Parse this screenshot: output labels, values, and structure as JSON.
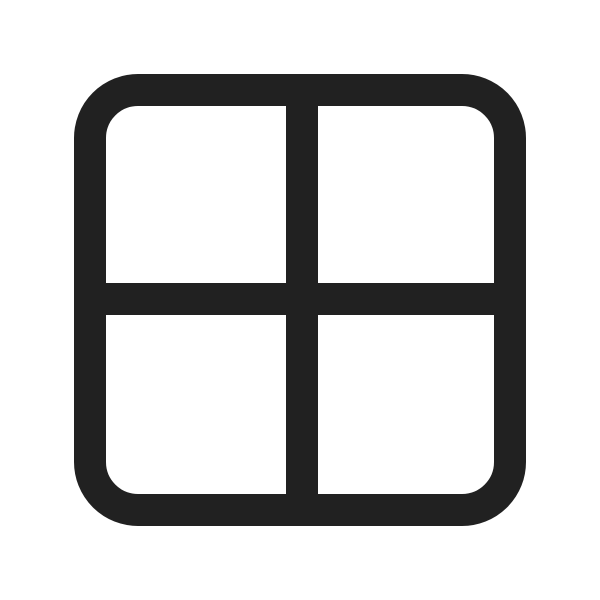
{
  "icon": {
    "name": "grid-icon",
    "color": "#212121",
    "background": "#ffffff"
  }
}
